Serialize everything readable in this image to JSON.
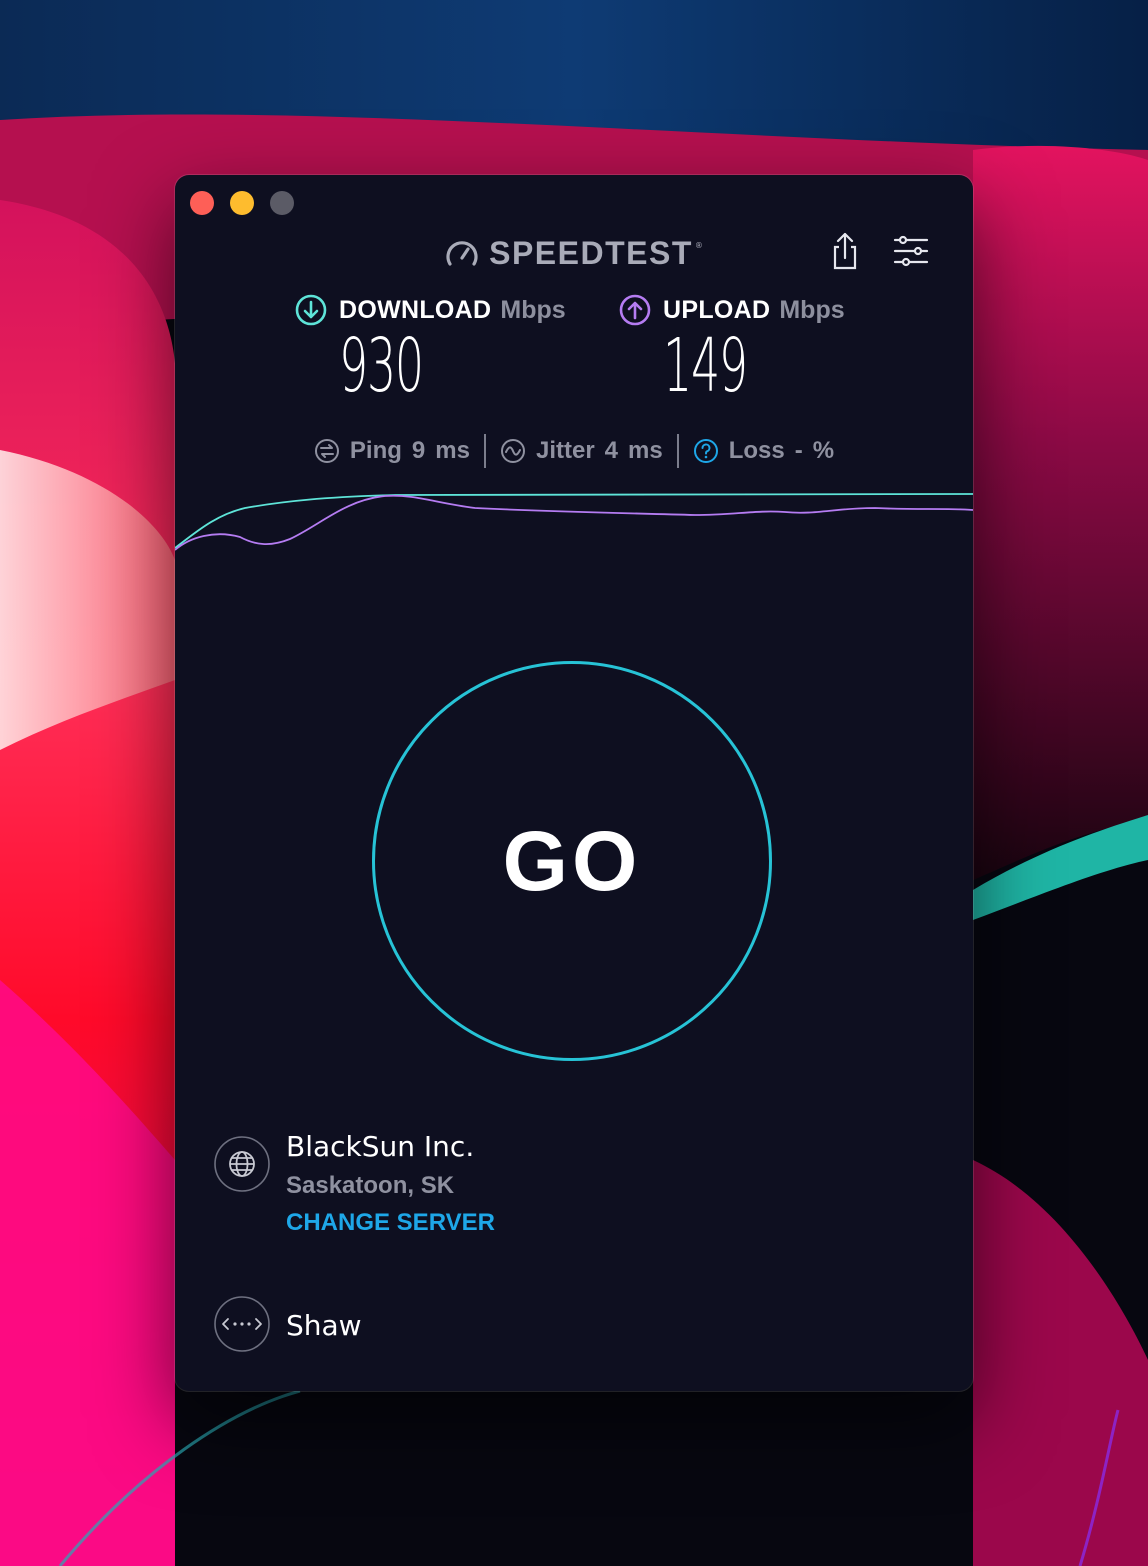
{
  "app": {
    "brand": "SPEEDTEST",
    "brand_mark": "®"
  },
  "toolbar": {
    "share_icon": "share-icon",
    "settings_icon": "sliders-icon"
  },
  "results": {
    "download": {
      "label": "DOWNLOAD",
      "unit": "Mbps",
      "value": "930",
      "color": "#5ee4d8"
    },
    "upload": {
      "label": "UPLOAD",
      "unit": "Mbps",
      "value": "149",
      "color": "#b57cf2"
    }
  },
  "latency": {
    "ping": {
      "label": "Ping",
      "value": "9",
      "unit": "ms"
    },
    "jitter": {
      "label": "Jitter",
      "value": "4",
      "unit": "ms"
    },
    "loss": {
      "label": "Loss",
      "value": "-",
      "unit": "%"
    }
  },
  "go_button": {
    "label": "GO",
    "ring_color": "#27c3d6"
  },
  "server": {
    "name": "BlackSun Inc.",
    "location": "Saskatoon, SK",
    "change_label": "CHANGE SERVER"
  },
  "provider": {
    "name": "Shaw"
  },
  "colors": {
    "window_bg": "#0e0f20",
    "accent_blue": "#1ea7e8",
    "muted_text": "#8f91a0"
  }
}
